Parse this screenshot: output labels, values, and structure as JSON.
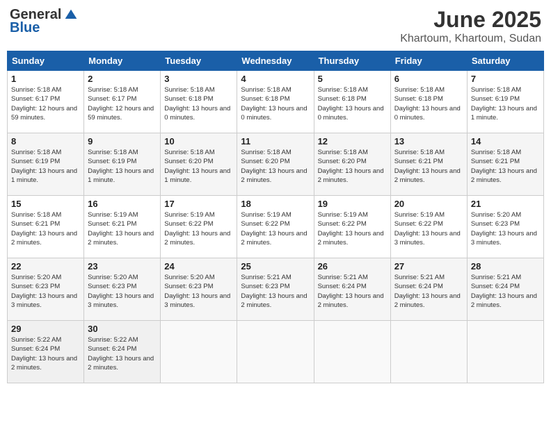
{
  "header": {
    "logo_general": "General",
    "logo_blue": "Blue",
    "month_title": "June 2025",
    "location": "Khartoum, Khartoum, Sudan"
  },
  "weekdays": [
    "Sunday",
    "Monday",
    "Tuesday",
    "Wednesday",
    "Thursday",
    "Friday",
    "Saturday"
  ],
  "weeks": [
    [
      {
        "day": "1",
        "sunrise": "5:18 AM",
        "sunset": "6:17 PM",
        "daylight": "12 hours and 59 minutes."
      },
      {
        "day": "2",
        "sunrise": "5:18 AM",
        "sunset": "6:17 PM",
        "daylight": "12 hours and 59 minutes."
      },
      {
        "day": "3",
        "sunrise": "5:18 AM",
        "sunset": "6:18 PM",
        "daylight": "13 hours and 0 minutes."
      },
      {
        "day": "4",
        "sunrise": "5:18 AM",
        "sunset": "6:18 PM",
        "daylight": "13 hours and 0 minutes."
      },
      {
        "day": "5",
        "sunrise": "5:18 AM",
        "sunset": "6:18 PM",
        "daylight": "13 hours and 0 minutes."
      },
      {
        "day": "6",
        "sunrise": "5:18 AM",
        "sunset": "6:18 PM",
        "daylight": "13 hours and 0 minutes."
      },
      {
        "day": "7",
        "sunrise": "5:18 AM",
        "sunset": "6:19 PM",
        "daylight": "13 hours and 1 minute."
      }
    ],
    [
      {
        "day": "8",
        "sunrise": "5:18 AM",
        "sunset": "6:19 PM",
        "daylight": "13 hours and 1 minute."
      },
      {
        "day": "9",
        "sunrise": "5:18 AM",
        "sunset": "6:19 PM",
        "daylight": "13 hours and 1 minute."
      },
      {
        "day": "10",
        "sunrise": "5:18 AM",
        "sunset": "6:20 PM",
        "daylight": "13 hours and 1 minute."
      },
      {
        "day": "11",
        "sunrise": "5:18 AM",
        "sunset": "6:20 PM",
        "daylight": "13 hours and 2 minutes."
      },
      {
        "day": "12",
        "sunrise": "5:18 AM",
        "sunset": "6:20 PM",
        "daylight": "13 hours and 2 minutes."
      },
      {
        "day": "13",
        "sunrise": "5:18 AM",
        "sunset": "6:21 PM",
        "daylight": "13 hours and 2 minutes."
      },
      {
        "day": "14",
        "sunrise": "5:18 AM",
        "sunset": "6:21 PM",
        "daylight": "13 hours and 2 minutes."
      }
    ],
    [
      {
        "day": "15",
        "sunrise": "5:18 AM",
        "sunset": "6:21 PM",
        "daylight": "13 hours and 2 minutes."
      },
      {
        "day": "16",
        "sunrise": "5:19 AM",
        "sunset": "6:21 PM",
        "daylight": "13 hours and 2 minutes."
      },
      {
        "day": "17",
        "sunrise": "5:19 AM",
        "sunset": "6:22 PM",
        "daylight": "13 hours and 2 minutes."
      },
      {
        "day": "18",
        "sunrise": "5:19 AM",
        "sunset": "6:22 PM",
        "daylight": "13 hours and 2 minutes."
      },
      {
        "day": "19",
        "sunrise": "5:19 AM",
        "sunset": "6:22 PM",
        "daylight": "13 hours and 2 minutes."
      },
      {
        "day": "20",
        "sunrise": "5:19 AM",
        "sunset": "6:22 PM",
        "daylight": "13 hours and 3 minutes."
      },
      {
        "day": "21",
        "sunrise": "5:20 AM",
        "sunset": "6:23 PM",
        "daylight": "13 hours and 3 minutes."
      }
    ],
    [
      {
        "day": "22",
        "sunrise": "5:20 AM",
        "sunset": "6:23 PM",
        "daylight": "13 hours and 3 minutes."
      },
      {
        "day": "23",
        "sunrise": "5:20 AM",
        "sunset": "6:23 PM",
        "daylight": "13 hours and 3 minutes."
      },
      {
        "day": "24",
        "sunrise": "5:20 AM",
        "sunset": "6:23 PM",
        "daylight": "13 hours and 3 minutes."
      },
      {
        "day": "25",
        "sunrise": "5:21 AM",
        "sunset": "6:23 PM",
        "daylight": "13 hours and 2 minutes."
      },
      {
        "day": "26",
        "sunrise": "5:21 AM",
        "sunset": "6:24 PM",
        "daylight": "13 hours and 2 minutes."
      },
      {
        "day": "27",
        "sunrise": "5:21 AM",
        "sunset": "6:24 PM",
        "daylight": "13 hours and 2 minutes."
      },
      {
        "day": "28",
        "sunrise": "5:21 AM",
        "sunset": "6:24 PM",
        "daylight": "13 hours and 2 minutes."
      }
    ],
    [
      {
        "day": "29",
        "sunrise": "5:22 AM",
        "sunset": "6:24 PM",
        "daylight": "13 hours and 2 minutes."
      },
      {
        "day": "30",
        "sunrise": "5:22 AM",
        "sunset": "6:24 PM",
        "daylight": "13 hours and 2 minutes."
      },
      null,
      null,
      null,
      null,
      null
    ]
  ]
}
